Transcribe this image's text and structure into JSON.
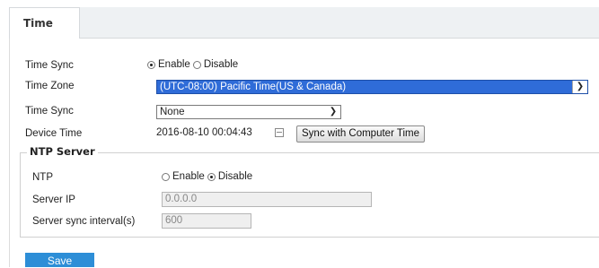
{
  "tabs": [
    {
      "label": "Time"
    }
  ],
  "time_sync_mode": {
    "label": "Time Sync",
    "options": [
      "Enable",
      "Disable"
    ],
    "selected": "Enable"
  },
  "time_zone": {
    "label": "Time Zone",
    "value": "(UTC-08:00) Pacific Time(US & Canada)"
  },
  "time_sync_source": {
    "label": "Time Sync",
    "value": "None"
  },
  "device_time": {
    "label": "Device Time",
    "value": "2016-08-10 00:04:43",
    "sync_button": "Sync with Computer Time"
  },
  "ntp_server": {
    "legend": "NTP Server",
    "ntp": {
      "label": "NTP",
      "options": [
        "Enable",
        "Disable"
      ],
      "selected": "Disable"
    },
    "server_ip": {
      "label": "Server IP",
      "value": "0.0.0.0"
    },
    "sync_interval": {
      "label": "Server sync interval(s)",
      "value": "600"
    }
  },
  "save_label": "Save"
}
